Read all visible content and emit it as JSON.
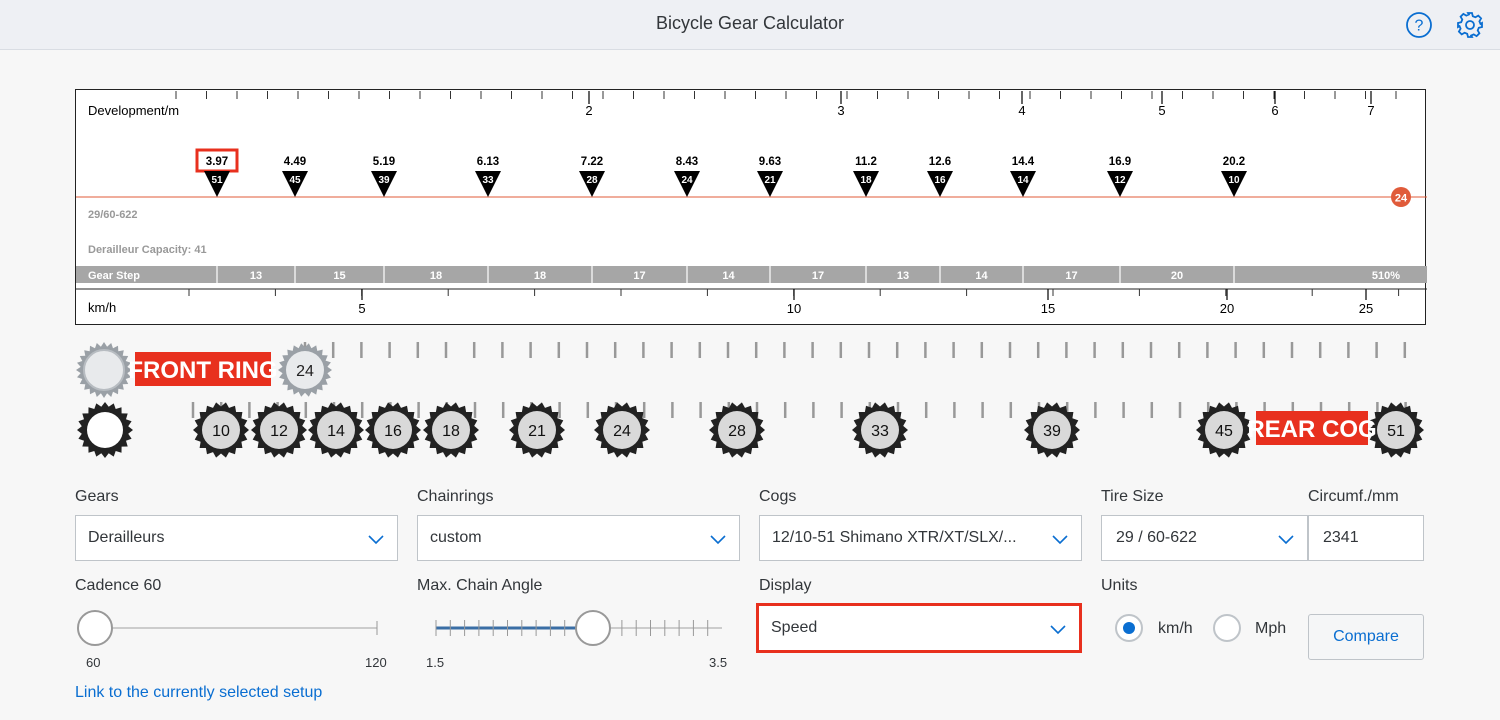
{
  "header": {
    "title": "Bicycle Gear Calculator",
    "help_icon": "help-icon",
    "settings_icon": "gear-icon"
  },
  "chart": {
    "development_label": "Development/m",
    "development_ticks": [
      "2",
      "3",
      "4",
      "5",
      "6",
      "7"
    ],
    "gears": [
      {
        "value": "3.97",
        "cog": "51",
        "selected": true
      },
      {
        "value": "4.49",
        "cog": "45"
      },
      {
        "value": "5.19",
        "cog": "39"
      },
      {
        "value": "6.13",
        "cog": "33"
      },
      {
        "value": "7.22",
        "cog": "28"
      },
      {
        "value": "8.43",
        "cog": "24"
      },
      {
        "value": "9.63",
        "cog": "21"
      },
      {
        "value": "11.2",
        "cog": "18"
      },
      {
        "value": "12.6",
        "cog": "16"
      },
      {
        "value": "14.4",
        "cog": "14"
      },
      {
        "value": "16.9",
        "cog": "12"
      },
      {
        "value": "20.2",
        "cog": "10"
      }
    ],
    "chainring_badge": "24",
    "tire_label": "29/60-622",
    "capacity_label": "Derailleur Capacity: 41",
    "gear_step_label": "Gear Step",
    "gear_steps": [
      "13",
      "15",
      "18",
      "18",
      "17",
      "14",
      "17",
      "13",
      "14",
      "17",
      "20"
    ],
    "range_label": "510%",
    "speed_label": "km/h",
    "speed_ticks": [
      "5",
      "10",
      "15",
      "20",
      "25"
    ],
    "accent_color": "#e05b3a",
    "selected_color": "#e8301e"
  },
  "wheels": {
    "front_label": "FRONT RING",
    "front_ring": "24",
    "rear_label": "REAR COG",
    "cogs": [
      "10",
      "12",
      "14",
      "16",
      "18",
      "21",
      "24",
      "28",
      "33",
      "39",
      "45",
      "51"
    ]
  },
  "form": {
    "gears": {
      "label": "Gears",
      "value": "Derailleurs"
    },
    "chainrings": {
      "label": "Chainrings",
      "value": "custom"
    },
    "cogs": {
      "label": "Cogs",
      "value": "12/10-51 Shimano XTR/XT/SLX/..."
    },
    "tire": {
      "label": "Tire Size",
      "value": "29 / 60-622"
    },
    "circumference": {
      "label": "Circumf./mm",
      "value": "2341"
    },
    "cadence": {
      "label": "Cadence 60",
      "min": "60",
      "max": "120",
      "level": 0
    },
    "chain_angle": {
      "label": "Max. Chain Angle",
      "min": "1.5",
      "max": "3.5",
      "level": 0.5
    },
    "display": {
      "label": "Display",
      "value": "Speed"
    },
    "units": {
      "label": "Units",
      "kmh": "km/h",
      "mph": "Mph",
      "selected": "km/h"
    },
    "compare_button": "Compare",
    "link": "Link to the currently selected setup"
  }
}
